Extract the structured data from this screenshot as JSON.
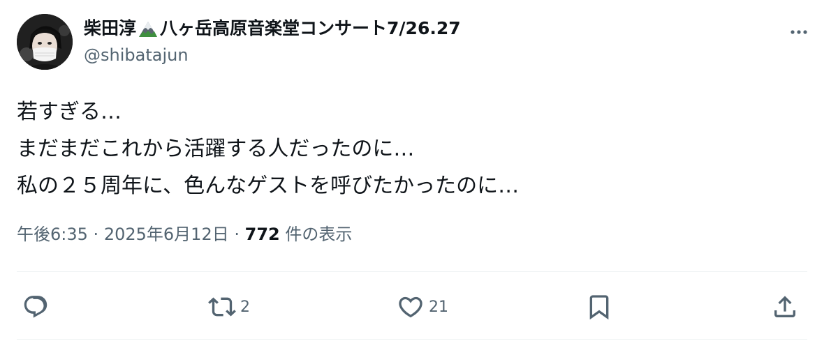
{
  "author": {
    "display_name_prefix": "柴田淳",
    "display_name_suffix": "八ヶ岳高原音楽堂コンサート7/26.27",
    "handle": "@shibatajun"
  },
  "tweet": {
    "lines": [
      "若すぎる…",
      "まだまだこれから活躍する人だったのに…",
      "私の２５周年に、色んなゲストを呼びたかったのに…"
    ]
  },
  "meta": {
    "time": "午後6:35",
    "separator": "·",
    "date": "2025年6月12日",
    "views_count": "772",
    "views_label": "件の表示"
  },
  "actions": {
    "reply_count": "",
    "retweet_count": "2",
    "like_count": "21"
  },
  "colors": {
    "text": "#0f1419",
    "muted": "#536471",
    "divider": "#eff3f4"
  },
  "icons": [
    "mountain-emoji-icon",
    "more-icon",
    "reply-icon",
    "retweet-icon",
    "like-icon",
    "bookmark-icon",
    "share-icon"
  ]
}
